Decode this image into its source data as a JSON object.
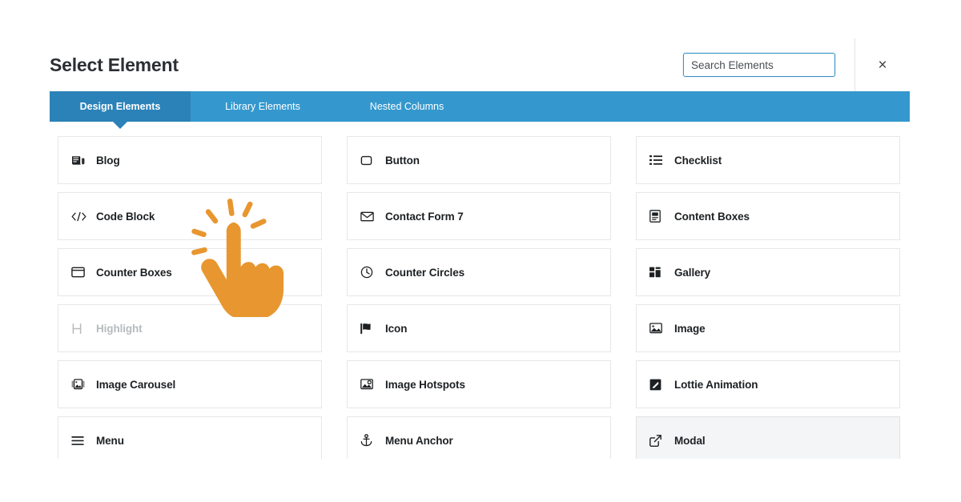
{
  "header": {
    "title": "Select Element",
    "search": {
      "placeholder": "Search Elements",
      "value": ""
    },
    "close_label": "×"
  },
  "tabs": [
    {
      "label": "Design Elements",
      "active": true
    },
    {
      "label": "Library Elements",
      "active": false
    },
    {
      "label": "Nested Columns",
      "active": false
    }
  ],
  "elements": [
    {
      "label": "Blog",
      "icon": "blog-icon",
      "state": "normal"
    },
    {
      "label": "Button",
      "icon": "button-icon",
      "state": "normal"
    },
    {
      "label": "Checklist",
      "icon": "checklist-icon",
      "state": "normal"
    },
    {
      "label": "Code Block",
      "icon": "code-icon",
      "state": "normal"
    },
    {
      "label": "Contact Form 7",
      "icon": "envelope-icon",
      "state": "normal"
    },
    {
      "label": "Content Boxes",
      "icon": "content-box-icon",
      "state": "normal"
    },
    {
      "label": "Counter Boxes",
      "icon": "counter-box-icon",
      "state": "normal"
    },
    {
      "label": "Counter Circles",
      "icon": "clock-icon",
      "state": "normal"
    },
    {
      "label": "Gallery",
      "icon": "gallery-icon",
      "state": "normal"
    },
    {
      "label": "Highlight",
      "icon": "highlight-icon",
      "state": "disabled"
    },
    {
      "label": "Icon",
      "icon": "flag-icon",
      "state": "normal"
    },
    {
      "label": "Image",
      "icon": "image-icon",
      "state": "normal"
    },
    {
      "label": "Image Carousel",
      "icon": "image-carousel-icon",
      "state": "normal"
    },
    {
      "label": "Image Hotspots",
      "icon": "image-hotspots-icon",
      "state": "normal"
    },
    {
      "label": "Lottie Animation",
      "icon": "lottie-icon",
      "state": "normal"
    },
    {
      "label": "Menu",
      "icon": "hamburger-icon",
      "state": "normal"
    },
    {
      "label": "Menu Anchor",
      "icon": "anchor-icon",
      "state": "normal"
    },
    {
      "label": "Modal",
      "icon": "external-link-icon",
      "state": "hovered"
    }
  ],
  "colors": {
    "tab_bar": "#3498ce",
    "tab_active": "#2b82b8",
    "cursor_orange": "#e8962f",
    "title_text": "#2b2f33",
    "card_border": "#e6e7e8",
    "hover_background": "#f4f5f6",
    "disabled_text": "#b7bbbe"
  }
}
